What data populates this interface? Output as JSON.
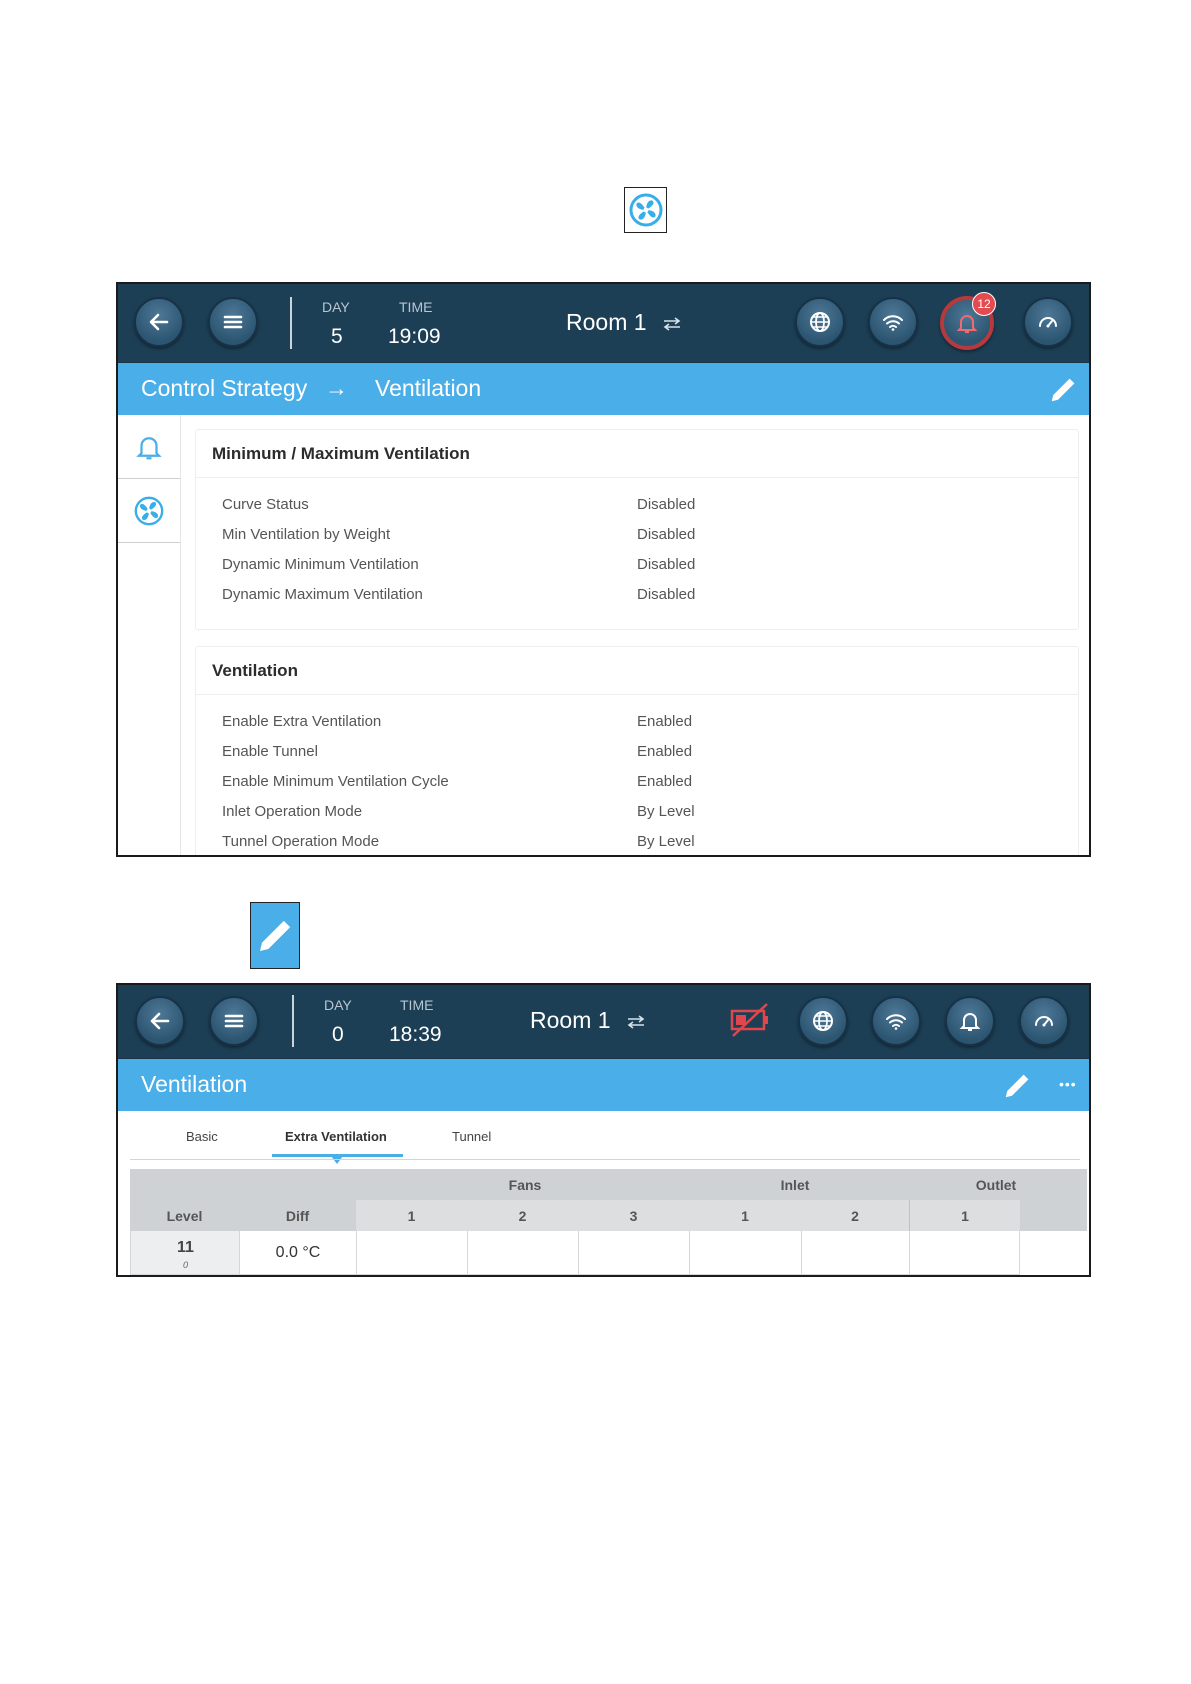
{
  "screen1": {
    "topbar": {
      "day_label": "DAY",
      "day_value": "5",
      "time_label": "TIME",
      "time_value": "19:09",
      "room": "Room 1",
      "alarm_count": "12"
    },
    "titlebar": {
      "breadcrumb_parent": "Control Strategy",
      "breadcrumb_separator": "→",
      "breadcrumb_current": "Ventilation"
    },
    "cards": [
      {
        "title": "Minimum / Maximum Ventilation",
        "rows": [
          {
            "label": "Curve Status",
            "value": "Disabled"
          },
          {
            "label": "Min Ventilation by Weight",
            "value": "Disabled"
          },
          {
            "label": "Dynamic Minimum Ventilation",
            "value": "Disabled"
          },
          {
            "label": "Dynamic Maximum Ventilation",
            "value": "Disabled"
          }
        ]
      },
      {
        "title": "Ventilation",
        "rows": [
          {
            "label": "Enable Extra Ventilation",
            "value": "Enabled"
          },
          {
            "label": "Enable Tunnel",
            "value": "Enabled"
          },
          {
            "label": "Enable Minimum Ventilation Cycle",
            "value": "Enabled"
          },
          {
            "label": "Inlet Operation Mode",
            "value": "By Level"
          },
          {
            "label": "Tunnel Operation Mode",
            "value": "By Level"
          }
        ]
      }
    ]
  },
  "screen2": {
    "topbar": {
      "day_label": "DAY",
      "day_value": "0",
      "time_label": "TIME",
      "time_value": "18:39",
      "room": "Room 1"
    },
    "titlebar": {
      "title": "Ventilation",
      "more_label": "•••"
    },
    "tabs": [
      "Basic",
      "Extra Ventilation",
      "Tunnel"
    ],
    "active_tab": "Extra Ventilation",
    "table": {
      "group_headers": {
        "fans": "Fans",
        "inlet": "Inlet",
        "outlet": "Outlet"
      },
      "col_level": "Level",
      "col_diff": "Diff",
      "fan_cols": [
        "1",
        "2",
        "3"
      ],
      "inlet_cols": [
        "1",
        "2"
      ],
      "outlet_cols": [
        "1"
      ],
      "row": {
        "level": "11",
        "level_sub": "0",
        "diff": "0.0 °C"
      }
    }
  },
  "colors": {
    "topbar": "#1d3f55",
    "accent": "#4aaee8",
    "alarm_ring": "#c0393b",
    "battery_warning": "#e0474c"
  },
  "icons": [
    "fan-icon",
    "pencil-icon",
    "back-arrow-icon",
    "menu-icon",
    "globe-icon",
    "wifi-icon",
    "bell-icon",
    "gauge-icon",
    "battery-crossed-icon",
    "swap-arrows-icon"
  ]
}
